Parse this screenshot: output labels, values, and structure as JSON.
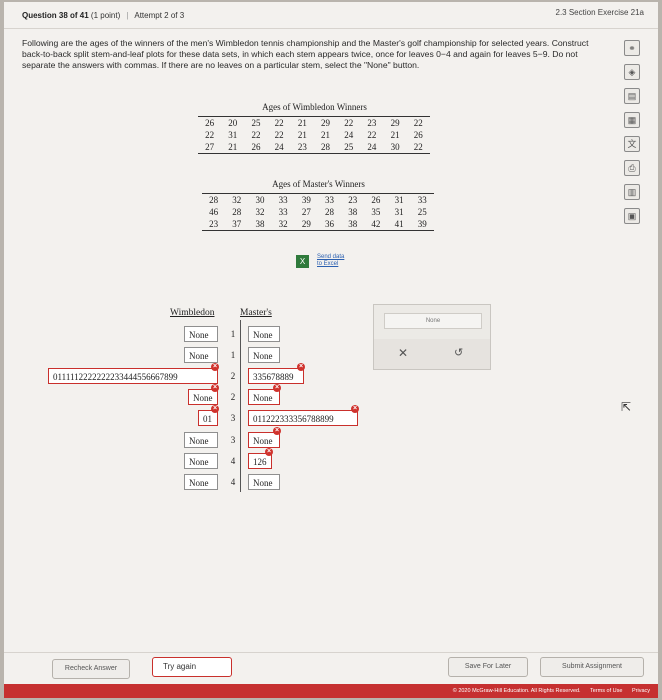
{
  "header": {
    "question": "Question 38 of 41",
    "points": "(1 point)",
    "attempt": "Attempt 2 of 3",
    "section": "2.3 Section Exercise 21a"
  },
  "prompt": {
    "p1": "Following are the ages of the winners of the men's Wimbledon tennis championship and the Master's golf championship for selected years. Construct back-to-back split stem-and-leaf plots for these data sets, in which each stem appears twice, once for leaves ",
    "range1": "0−4",
    "p2": " and again for leaves ",
    "range2": "5−9",
    "p3": ". Do not separate the answers with commas. If there are no leaves on a particular stem, select the \"None\" button."
  },
  "wimbledon_table": {
    "title": "Ages of Wimbledon Winners",
    "rows": [
      [
        "26",
        "20",
        "25",
        "22",
        "21",
        "29",
        "22",
        "23",
        "29",
        "22"
      ],
      [
        "22",
        "31",
        "22",
        "22",
        "21",
        "21",
        "24",
        "22",
        "21",
        "26"
      ],
      [
        "27",
        "21",
        "26",
        "24",
        "23",
        "28",
        "25",
        "24",
        "30",
        "22"
      ]
    ]
  },
  "masters_table": {
    "title": "Ages of Master's Winners",
    "rows": [
      [
        "28",
        "32",
        "30",
        "33",
        "39",
        "33",
        "23",
        "26",
        "31",
        "33"
      ],
      [
        "46",
        "28",
        "32",
        "33",
        "27",
        "28",
        "38",
        "35",
        "31",
        "25"
      ],
      [
        "23",
        "37",
        "38",
        "32",
        "29",
        "36",
        "38",
        "42",
        "41",
        "39"
      ]
    ]
  },
  "excel_link": {
    "line1": "Send data",
    "line2": "to Excel"
  },
  "plot": {
    "left_header": "Wimbledon",
    "right_header": "Master's",
    "stems": [
      "1",
      "1",
      "2",
      "2",
      "3",
      "3",
      "4",
      "4"
    ],
    "left": [
      "None",
      "None",
      "0111112222222233444556667899",
      "None",
      "01",
      "None",
      "None",
      "None"
    ],
    "right": [
      "None",
      "None",
      "335678889",
      "None",
      "011222333356788899",
      "None",
      "126",
      "None"
    ]
  },
  "palette": {
    "none_label": "None",
    "clear_symbol": "✕",
    "undo_symbol": "↺"
  },
  "buttons": {
    "recheck": "Recheck Answer",
    "try_again": "Try again",
    "save_later": "Save For Later",
    "submit": "Submit Assignment"
  },
  "footer": {
    "copyright": "© 2020 McGraw-Hill Education. All Rights Reserved.",
    "terms": "Terms of Use",
    "privacy": "Privacy"
  },
  "side_icons": [
    "link-icon",
    "compass-icon",
    "book-icon",
    "calculator-icon",
    "translate-icon",
    "print-icon",
    "bar-chart-icon",
    "document-icon"
  ],
  "colors": {
    "error": "#c9302c",
    "footer": "#c63030",
    "link": "#2a5fb0"
  }
}
